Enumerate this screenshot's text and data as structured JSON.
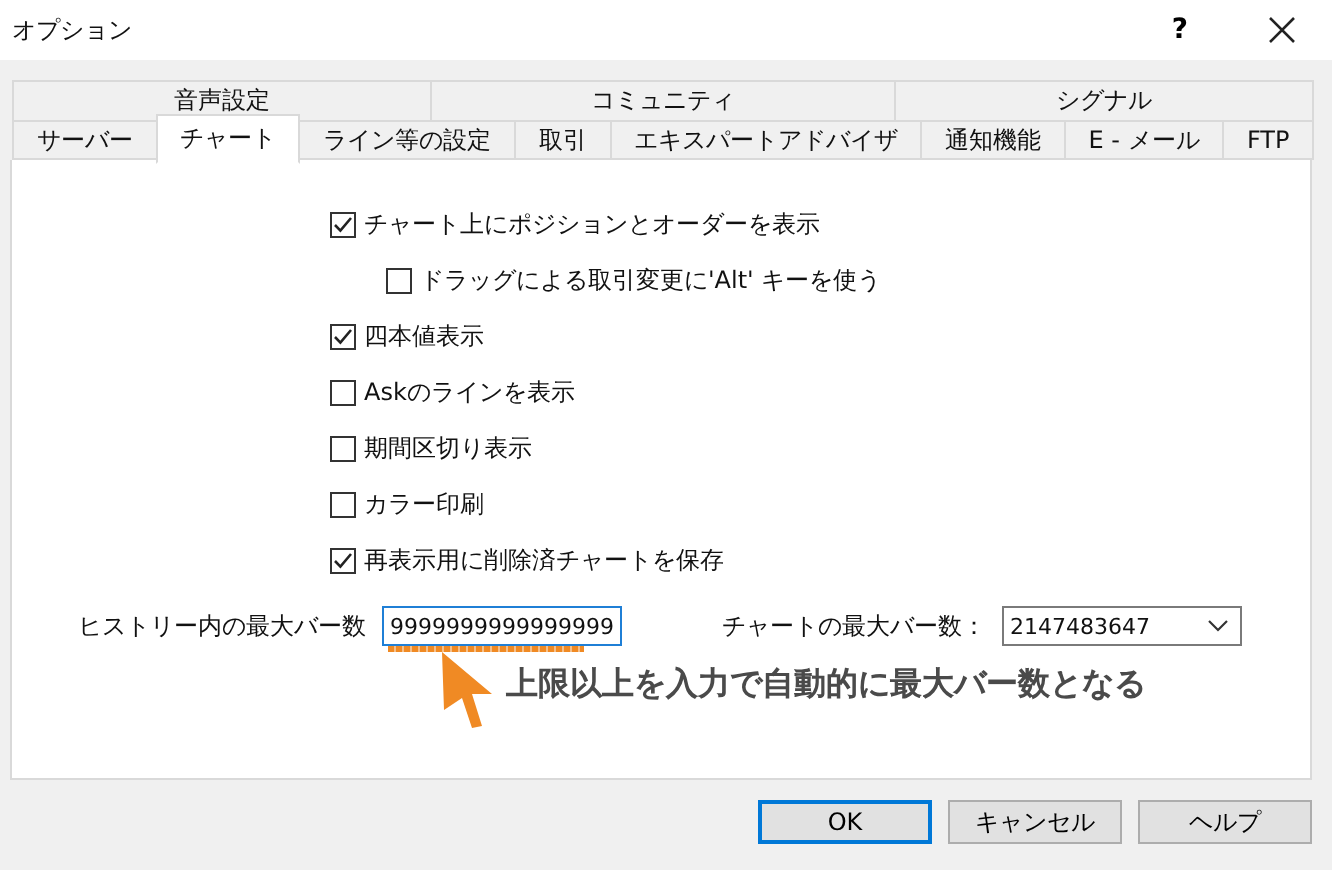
{
  "window": {
    "title": "オプション",
    "help": "?"
  },
  "tab_rows": [
    [
      {
        "label": "音声設定",
        "selected": false
      },
      {
        "label": "コミュニティ",
        "selected": false
      },
      {
        "label": "シグナル",
        "selected": false
      }
    ],
    [
      {
        "label": "サーバー",
        "selected": false
      },
      {
        "label": "チャート",
        "selected": true
      },
      {
        "label": "ライン等の設定",
        "selected": false
      },
      {
        "label": "取引",
        "selected": false
      },
      {
        "label": "エキスパートアドバイザ",
        "selected": false
      },
      {
        "label": "通知機能",
        "selected": false
      },
      {
        "label": "E - メール",
        "selected": false
      },
      {
        "label": "FTP",
        "selected": false
      }
    ]
  ],
  "options": [
    {
      "label": "チャート上にポジションとオーダーを表示",
      "checked": true,
      "children": [
        {
          "label": "ドラッグによる取引変更に'Alt' キーを使う",
          "checked": false
        }
      ]
    },
    {
      "label": "四本値表示",
      "checked": true
    },
    {
      "label": "Askのラインを表示",
      "checked": false
    },
    {
      "label": "期間区切り表示",
      "checked": false
    },
    {
      "label": "カラー印刷",
      "checked": false
    },
    {
      "label": "再表示用に削除済チャートを保存",
      "checked": true
    }
  ],
  "combos": [
    {
      "label": "ヒストリー内の最大バー数",
      "value": "9999999999999999",
      "focused": true,
      "underlined": true
    },
    {
      "label": "チャートの最大バー数：",
      "value": "2147483647",
      "focused": false,
      "underlined": false
    }
  ],
  "annotation": {
    "text": "上限以上を入力で自動的に最大バー数となる"
  },
  "buttons": [
    {
      "label": "OK",
      "default": true
    },
    {
      "label": "キャンセル",
      "default": false
    },
    {
      "label": "ヘルプ",
      "default": false
    }
  ]
}
